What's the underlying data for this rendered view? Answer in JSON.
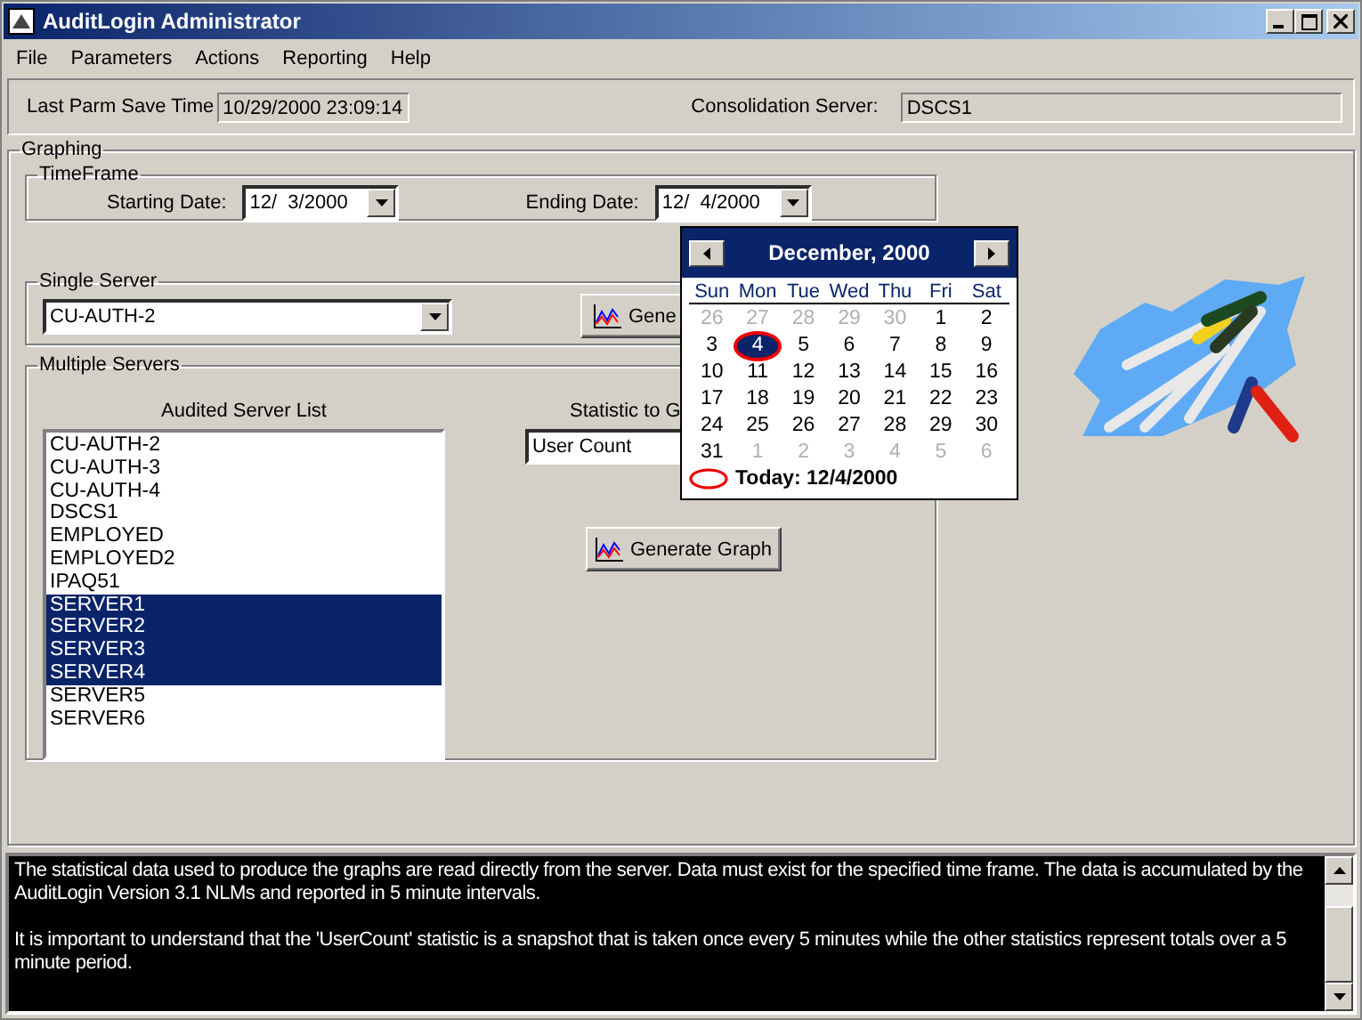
{
  "window": {
    "title": "AuditLogin Administrator"
  },
  "menu": [
    "File",
    "Parameters",
    "Actions",
    "Reporting",
    "Help"
  ],
  "status_fields": [
    {
      "label": "Last Parm Save Time",
      "value": "10/29/2000 23:09:14"
    },
    {
      "label": "Consolidation Server:",
      "value": "DSCS1"
    }
  ],
  "graphing": {
    "title": "Graphing",
    "timeframe": {
      "title": "TimeFrame",
      "starting_label": "Starting Date:",
      "starting_value": "12/  3/2000",
      "ending_label": "Ending Date:",
      "ending_value": "12/  4/2000"
    },
    "single_server": {
      "title": "Single Server",
      "server": "CU-AUTH-2",
      "button": "Gene"
    },
    "multiple_servers": {
      "title": "Multiple Servers",
      "list_title": "Audited Server List",
      "statistic_label": "Statistic to G",
      "statistic": "User Count",
      "button": "Generate Graph",
      "servers": [
        {
          "name": "CU-AUTH-2",
          "selected": false
        },
        {
          "name": "CU-AUTH-3",
          "selected": false
        },
        {
          "name": "CU-AUTH-4",
          "selected": false
        },
        {
          "name": "DSCS1",
          "selected": false
        },
        {
          "name": "EMPLOYED",
          "selected": false
        },
        {
          "name": "EMPLOYED2",
          "selected": false
        },
        {
          "name": "IPAQ51",
          "selected": false
        },
        {
          "name": "SERVER1",
          "selected": true
        },
        {
          "name": "SERVER2",
          "selected": true
        },
        {
          "name": "SERVER3",
          "selected": true
        },
        {
          "name": "SERVER4",
          "selected": true
        },
        {
          "name": "SERVER5",
          "selected": false
        },
        {
          "name": "SERVER6",
          "selected": false
        }
      ]
    }
  },
  "calendar": {
    "month": "December, 2000",
    "weekdays": [
      "Sun",
      "Mon",
      "Tue",
      "Wed",
      "Thu",
      "Fri",
      "Sat"
    ],
    "today": "Today: 12/4/2000",
    "days": [
      {
        "text": "26",
        "other_month": true,
        "selected": false,
        "today": false
      },
      {
        "text": "27",
        "other_month": true,
        "selected": false,
        "today": false
      },
      {
        "text": "28",
        "other_month": true,
        "selected": false,
        "today": false
      },
      {
        "text": "29",
        "other_month": true,
        "selected": false,
        "today": false
      },
      {
        "text": "30",
        "other_month": true,
        "selected": false,
        "today": false
      },
      {
        "text": "1",
        "other_month": false,
        "selected": false,
        "today": false
      },
      {
        "text": "2",
        "other_month": false,
        "selected": false,
        "today": false
      },
      {
        "text": "3",
        "other_month": false,
        "selected": false,
        "today": false
      },
      {
        "text": "4",
        "other_month": false,
        "selected": true,
        "today": true
      },
      {
        "text": "5",
        "other_month": false,
        "selected": false,
        "today": false
      },
      {
        "text": "6",
        "other_month": false,
        "selected": false,
        "today": false
      },
      {
        "text": "7",
        "other_month": false,
        "selected": false,
        "today": false
      },
      {
        "text": "8",
        "other_month": false,
        "selected": false,
        "today": false
      },
      {
        "text": "9",
        "other_month": false,
        "selected": false,
        "today": false
      },
      {
        "text": "10",
        "other_month": false,
        "selected": false,
        "today": false
      },
      {
        "text": "11",
        "other_month": false,
        "selected": false,
        "today": false
      },
      {
        "text": "12",
        "other_month": false,
        "selected": false,
        "today": false
      },
      {
        "text": "13",
        "other_month": false,
        "selected": false,
        "today": false
      },
      {
        "text": "14",
        "other_month": false,
        "selected": false,
        "today": false
      },
      {
        "text": "15",
        "other_month": false,
        "selected": false,
        "today": false
      },
      {
        "text": "16",
        "other_month": false,
        "selected": false,
        "today": false
      },
      {
        "text": "17",
        "other_month": false,
        "selected": false,
        "today": false
      },
      {
        "text": "18",
        "other_month": false,
        "selected": false,
        "today": false
      },
      {
        "text": "19",
        "other_month": false,
        "selected": false,
        "today": false
      },
      {
        "text": "20",
        "other_month": false,
        "selected": false,
        "today": false
      },
      {
        "text": "21",
        "other_month": false,
        "selected": false,
        "today": false
      },
      {
        "text": "22",
        "other_month": false,
        "selected": false,
        "today": false
      },
      {
        "text": "23",
        "other_month": false,
        "selected": false,
        "today": false
      },
      {
        "text": "24",
        "other_month": false,
        "selected": false,
        "today": false
      },
      {
        "text": "25",
        "other_month": false,
        "selected": false,
        "today": false
      },
      {
        "text": "26",
        "other_month": false,
        "selected": false,
        "today": false
      },
      {
        "text": "27",
        "other_month": false,
        "selected": false,
        "today": false
      },
      {
        "text": "28",
        "other_month": false,
        "selected": false,
        "today": false
      },
      {
        "text": "29",
        "other_month": false,
        "selected": false,
        "today": false
      },
      {
        "text": "30",
        "other_month": false,
        "selected": false,
        "today": false
      },
      {
        "text": "31",
        "other_month": false,
        "selected": false,
        "today": false
      },
      {
        "text": "1",
        "other_month": true,
        "selected": false,
        "today": false
      },
      {
        "text": "2",
        "other_month": true,
        "selected": false,
        "today": false
      },
      {
        "text": "3",
        "other_month": true,
        "selected": false,
        "today": false
      },
      {
        "text": "4",
        "other_month": true,
        "selected": false,
        "today": false
      },
      {
        "text": "5",
        "other_month": true,
        "selected": false,
        "today": false
      },
      {
        "text": "6",
        "other_month": true,
        "selected": false,
        "today": false
      }
    ]
  },
  "info": [
    "The statistical data used to produce the graphs are read directly from the server. Data must exist for the specified time frame. The data is accumulated by the AuditLogin Version 3.1 NLMs and reported in 5 minute intervals.",
    "It is important to understand that the 'UserCount' statistic is a snapshot that is taken once every 5 minutes while the other statistics represent totals over a 5 minute period."
  ]
}
